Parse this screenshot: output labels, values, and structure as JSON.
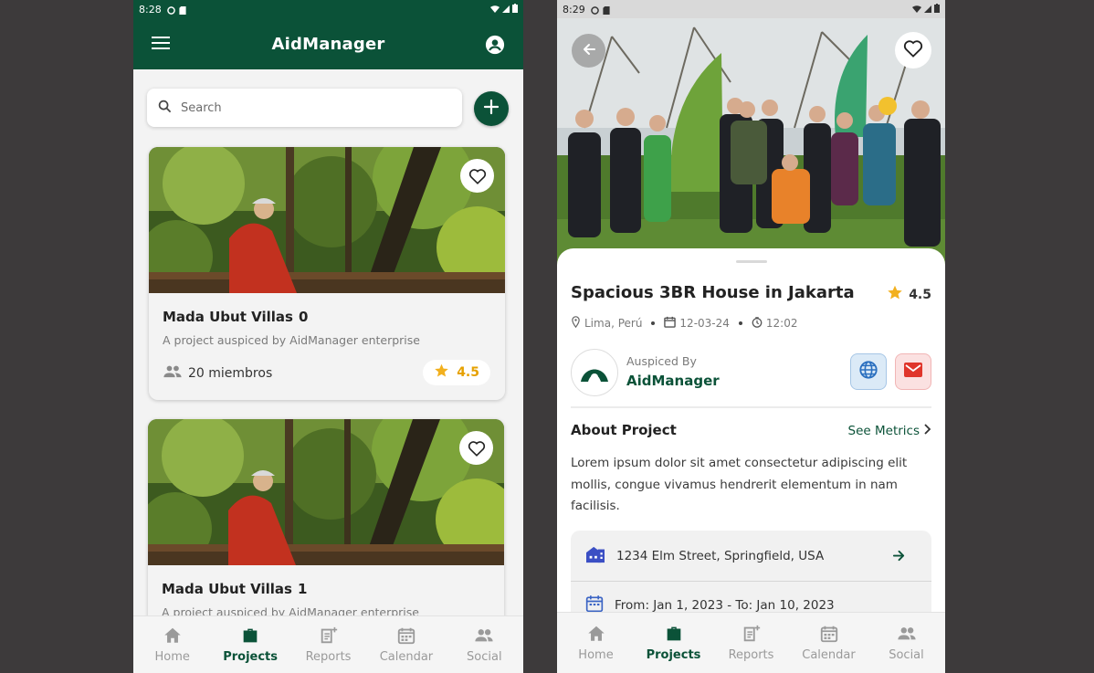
{
  "left_screen": {
    "status": {
      "time": "8:28"
    },
    "app_title": "AidManager",
    "search": {
      "placeholder": "Search"
    },
    "cards": [
      {
        "title": "Mada Ubut Villas",
        "index": "0",
        "subtitle": "A project auspiced by AidManager enterprise",
        "members": "20 miembros",
        "rating": "4.5"
      },
      {
        "title": "Mada Ubut Villas",
        "index": "1",
        "subtitle": "A project auspiced by AidManager enterprise"
      }
    ],
    "nav": [
      {
        "label": "Home",
        "icon": "home-icon"
      },
      {
        "label": "Projects",
        "icon": "briefcase-icon",
        "active": true
      },
      {
        "label": "Reports",
        "icon": "report-icon"
      },
      {
        "label": "Calendar",
        "icon": "calendar-icon"
      },
      {
        "label": "Social",
        "icon": "people-icon"
      }
    ]
  },
  "right_screen": {
    "status": {
      "time": "8:29"
    },
    "project": {
      "title": "Spacious 3BR House in Jakarta",
      "rating": "4.5",
      "location": "Lima, Perú",
      "date": "12-03-24",
      "time": "12:02"
    },
    "sponsor": {
      "label": "Auspiced By",
      "name": "AidManager"
    },
    "about": {
      "title": "About Project",
      "link": "See Metrics",
      "text": "Lorem ipsum dolor sit amet consectetur adipiscing elit mollis, congue vivamus hendrerit elementum in nam facilisis."
    },
    "info": {
      "address": "1234 Elm Street, Springfield, USA",
      "dates": "From: Jan 1, 2023 - To: Jan 10, 2023"
    },
    "nav": [
      {
        "label": "Home",
        "icon": "home-icon"
      },
      {
        "label": "Projects",
        "icon": "briefcase-icon",
        "active": true
      },
      {
        "label": "Reports",
        "icon": "report-icon"
      },
      {
        "label": "Calendar",
        "icon": "calendar-icon"
      },
      {
        "label": "Social",
        "icon": "people-icon"
      }
    ]
  },
  "colors": {
    "brand": "#0b5238",
    "star": "#f2b01e",
    "muted": "#9a9a9a"
  }
}
